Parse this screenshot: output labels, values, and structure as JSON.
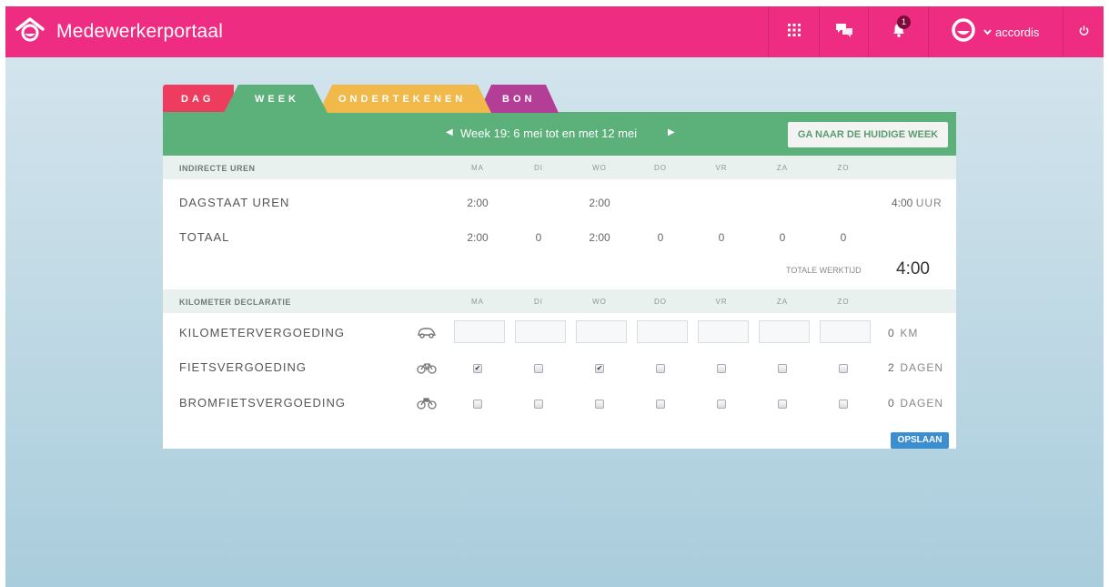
{
  "header": {
    "title": "Medewerkerportaal",
    "notification_count": "1",
    "user_name": "accordis"
  },
  "tabs": [
    {
      "label": "DAG"
    },
    {
      "label": "WEEK"
    },
    {
      "label": "ONDERTEKENEN"
    },
    {
      "label": "BON"
    }
  ],
  "week": {
    "label": "Week 19: 6 mei tot en met 12 mei",
    "current_week_button": "GA NAAR DE HUIDIGE WEEK"
  },
  "days": [
    "MA",
    "DI",
    "WO",
    "DO",
    "VR",
    "ZA",
    "ZO"
  ],
  "indirect": {
    "heading": "INDIRECTE UREN",
    "rows": [
      {
        "label": "DAGSTAAT UREN",
        "values": [
          "2:00",
          "",
          "2:00",
          "",
          "",
          "",
          ""
        ],
        "total": "4:00",
        "unit": "UUR"
      },
      {
        "label": "TOTAAL",
        "values": [
          "2:00",
          "0",
          "2:00",
          "0",
          "0",
          "0",
          "0"
        ],
        "total": "",
        "unit": ""
      }
    ],
    "total_work_label": "TOTALE WERKTIJD",
    "total_work_value": "4:00"
  },
  "kilometer": {
    "heading": "KILOMETER DECLARATIE",
    "rows": [
      {
        "label": "KILOMETERVERGOEDING",
        "icon": "car-icon",
        "total": "0",
        "unit": "KM"
      },
      {
        "label": "FIETSVERGOEDING",
        "icon": "bicycle-icon",
        "checked": [
          true,
          false,
          true,
          false,
          false,
          false,
          false
        ],
        "total": "2",
        "unit": "DAGEN"
      },
      {
        "label": "BROMFIETSVERGOEDING",
        "icon": "moped-icon",
        "checked": [
          false,
          false,
          false,
          false,
          false,
          false,
          false
        ],
        "total": "0",
        "unit": "DAGEN"
      }
    ],
    "save_label": "OPSLAAN"
  },
  "colors": {
    "topbar": "#ee2d82",
    "week_green": "#5cb07a",
    "tab_dag": "#ee3c5f",
    "tab_ondertekenen": "#f1b84a",
    "tab_bon": "#b33e96",
    "save_blue": "#3b8fd0"
  }
}
